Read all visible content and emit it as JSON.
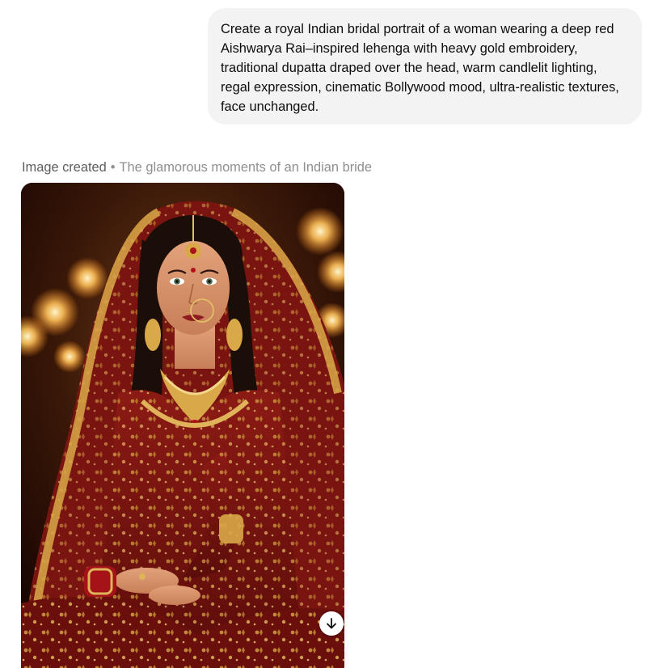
{
  "conversation": {
    "user_message": "Create a royal Indian bridal portrait of a woman wearing a deep red Aishwarya Rai–inspired lehenga with heavy gold embroidery, traditional dupatta draped over the head, warm candlelit lighting, regal expression, cinematic Bollywood mood, ultra-realistic textures, face unchanged.",
    "response_status": "Image created",
    "response_separator": "•",
    "response_subtitle": "The glamorous moments of an Indian bride"
  },
  "image": {
    "download_icon": "arrow-down-icon"
  }
}
